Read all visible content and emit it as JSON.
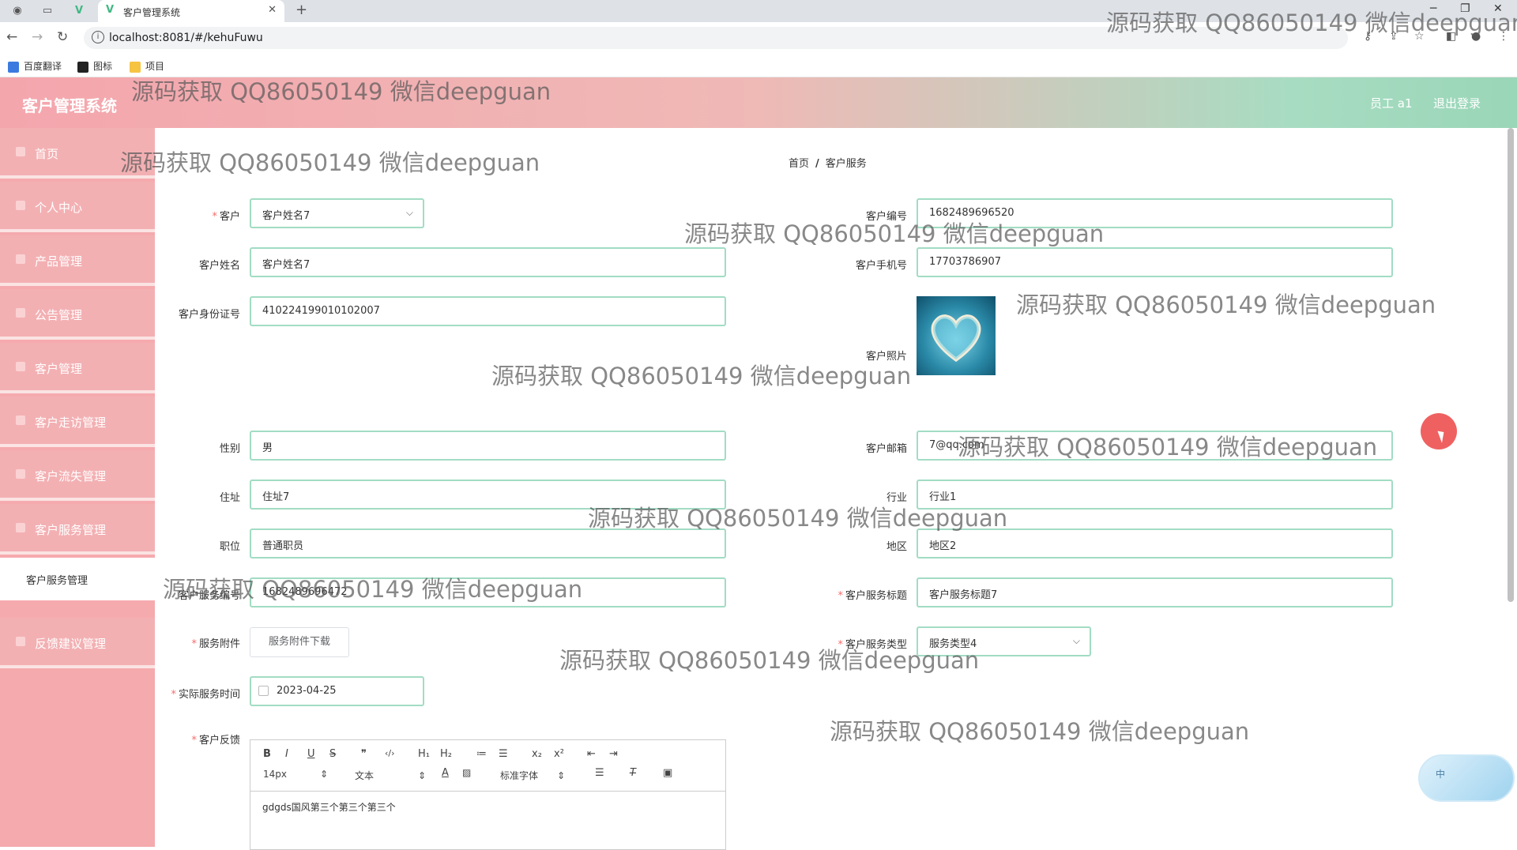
{
  "browser": {
    "tab_title": "客户管理系统",
    "url": "localhost:8081/#/kehuFuwu",
    "new_tab_symbol": "+",
    "close_symbol": "✕",
    "bookmarks": [
      "百度翻译",
      "图标",
      "项目"
    ]
  },
  "header": {
    "app_title": "客户管理系统",
    "user": "员工 a1",
    "logout": "退出登录"
  },
  "sidebar": {
    "items": [
      "首页",
      "个人中心",
      "产品管理",
      "公告管理",
      "客户管理",
      "客户走访管理",
      "客户流失管理",
      "客户服务管理"
    ],
    "sub_item": "客户服务管理",
    "after_items": [
      "反馈建议管理"
    ]
  },
  "breadcrumb": {
    "home": "首页",
    "sep": "/",
    "current": "客户服务"
  },
  "form": {
    "customer_label": "客户",
    "customer_value": "客户姓名7",
    "customer_no_label": "客户编号",
    "customer_no_value": "1682489696520",
    "name_label": "客户姓名",
    "name_value": "客户姓名7",
    "phone_label": "客户手机号",
    "phone_value": "17703786907",
    "idcard_label": "客户身份证号",
    "idcard_value": "410224199010102007",
    "photo_label": "客户照片",
    "gender_label": "性别",
    "gender_value": "男",
    "email_label": "客户邮箱",
    "email_value": "7@qq.com",
    "address_label": "住址",
    "address_value": "住址7",
    "industry_label": "行业",
    "industry_value": "行业1",
    "position_label": "职位",
    "position_value": "普通职员",
    "region_label": "地区",
    "region_value": "地区2",
    "service_no_label": "客户服务编号",
    "service_no_value": "1682489696472",
    "service_title_label": "客户服务标题",
    "service_title_value": "客户服务标题7",
    "attachment_label": "服务附件",
    "attachment_button": "服务附件下载",
    "service_type_label": "客户服务类型",
    "service_type_value": "服务类型4",
    "service_time_label": "实际服务时间",
    "service_time_value": "2023-04-25",
    "feedback_label": "客户反馈"
  },
  "editor": {
    "font_size": "14px",
    "text_type": "文本",
    "font_family": "标准字体",
    "content": "gdgds国风第三个第三个第三个",
    "buttons": [
      "B",
      "I",
      "U",
      "S",
      "❞",
      "‹/›",
      "H₁",
      "H₂",
      "≔",
      "☰",
      "x₂",
      "x²",
      "⇤",
      "⇥"
    ]
  },
  "widget": {
    "label": "中"
  },
  "watermark": "源码获取 QQ86050149 微信deepguan"
}
